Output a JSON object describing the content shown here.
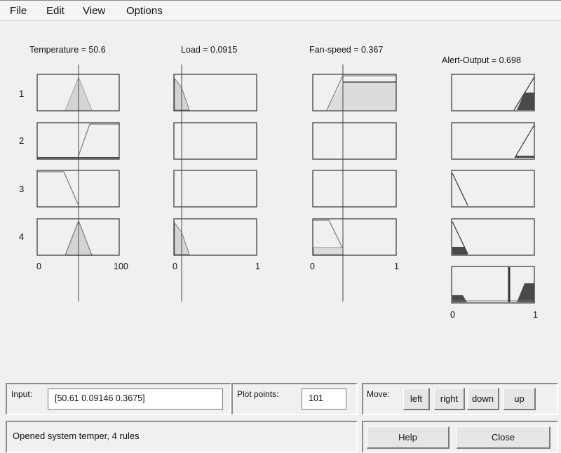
{
  "menu": {
    "file": "File",
    "edit": "Edit",
    "view": "View",
    "options": "Options"
  },
  "variables": {
    "temperature": "Temperature = 50.6",
    "load": "Load = 0.0915",
    "fan_speed": "Fan-speed = 0.367",
    "alert_output": "Alert-Output = 0.698"
  },
  "rule_numbers": [
    "1",
    "2",
    "3",
    "4"
  ],
  "axis_ticks": {
    "temperature": [
      "0",
      "100"
    ],
    "load": [
      "0",
      "1"
    ],
    "fan_speed": [
      "0",
      "1"
    ],
    "output": [
      "0",
      "1"
    ]
  },
  "inputs": {
    "temperature": 50.61,
    "load": 0.09146,
    "fan_speed": 0.3675
  },
  "output_value": 0.698,
  "bottom": {
    "input_label": "Input:",
    "input_value": "[50.61 0.09146 0.3675]",
    "plot_points_label": "Plot points:",
    "plot_points_value": "101",
    "move_label": "Move:",
    "move_left": "left",
    "move_right": "right",
    "move_down": "down",
    "move_up": "up",
    "status": "Opened system temper, 4 rules",
    "help": "Help",
    "close": "Close"
  }
}
